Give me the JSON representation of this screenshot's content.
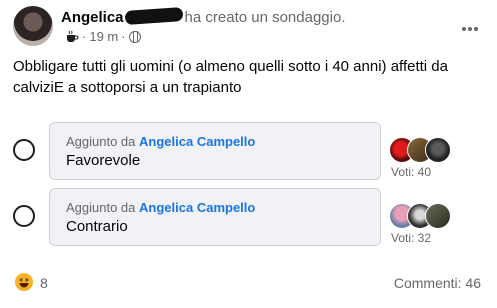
{
  "post": {
    "author_name": "Angelica",
    "action_text": "ha creato un sondaggio.",
    "time_ago": "19 m",
    "separator": "·",
    "more_icon": "more-horizontal-icon",
    "text": "Obbligare tutti gli uomini (o almeno quelli sotto i 40 anni) affetti da calviziE a sottoporsi a un trapianto"
  },
  "poll": {
    "options": [
      {
        "added_by_prefix": "Aggiunto da",
        "added_by_name": "Angelica Campello",
        "label": "Favorevole",
        "votes": "Voti: 40"
      },
      {
        "added_by_prefix": "Aggiunto da",
        "added_by_name": "Angelica Campello",
        "label": "Contrario",
        "votes": "Voti: 32"
      }
    ]
  },
  "footer": {
    "reaction_icon": "haha-reaction-icon",
    "reaction_count": "8",
    "comments": "Commenti: 46"
  },
  "colors": {
    "link_blue": "#1b74e4",
    "secondary_text": "#65676b",
    "option_bg": "#f0f2f5",
    "reaction_yellow": "#f7b125"
  }
}
